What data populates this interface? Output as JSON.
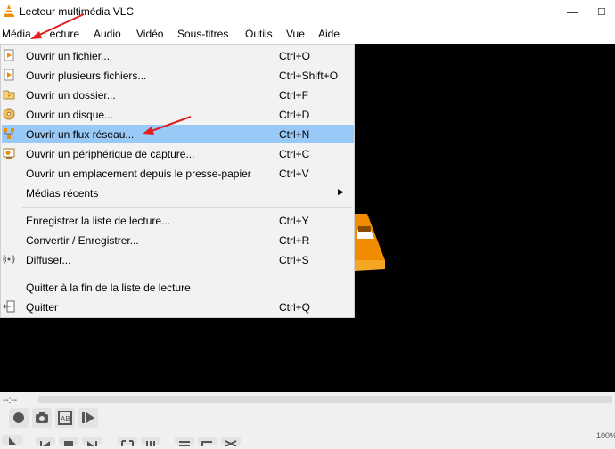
{
  "window": {
    "title": "Lecteur multimédia VLC"
  },
  "menubar": [
    {
      "label": "Média"
    },
    {
      "label": "Lecture"
    },
    {
      "label": "Audio"
    },
    {
      "label": "Vidéo"
    },
    {
      "label": "Sous-titres"
    },
    {
      "label": "Outils"
    },
    {
      "label": "Vue"
    },
    {
      "label": "Aide"
    }
  ],
  "media_menu": [
    {
      "label": "Ouvrir un fichier...",
      "shortcut": "Ctrl+O",
      "icon": "open-file-icon"
    },
    {
      "label": "Ouvrir plusieurs fichiers...",
      "shortcut": "Ctrl+Shift+O",
      "icon": "open-files-icon"
    },
    {
      "label": "Ouvrir un dossier...",
      "shortcut": "Ctrl+F",
      "icon": "folder-icon"
    },
    {
      "label": "Ouvrir un disque...",
      "shortcut": "Ctrl+D",
      "icon": "disc-icon"
    },
    {
      "label": "Ouvrir un flux réseau...",
      "shortcut": "Ctrl+N",
      "icon": "network-icon",
      "highlighted": true
    },
    {
      "label": "Ouvrir un périphérique de capture...",
      "shortcut": "Ctrl+C",
      "icon": "capture-device-icon"
    },
    {
      "label": "Ouvrir un emplacement depuis le presse-papier",
      "shortcut": "Ctrl+V"
    },
    {
      "label": "Médias récents",
      "submenu": true
    },
    {
      "label": "Enregistrer la liste de lecture...",
      "shortcut": "Ctrl+Y"
    },
    {
      "label": "Convertir / Enregistrer...",
      "shortcut": "Ctrl+R"
    },
    {
      "label": "Diffuser...",
      "shortcut": "Ctrl+S",
      "icon": "stream-icon"
    },
    {
      "label": "Quitter à la fin de la liste de lecture"
    },
    {
      "label": "Quitter",
      "shortcut": "Ctrl+Q",
      "icon": "exit-icon"
    }
  ],
  "player": {
    "time_elapsed": "--:--",
    "zoom_partial": "100%"
  },
  "colors": {
    "highlight": "#99c9f7",
    "annotation_arrow": "#e02020",
    "vlc_orange": "#f08c00"
  }
}
